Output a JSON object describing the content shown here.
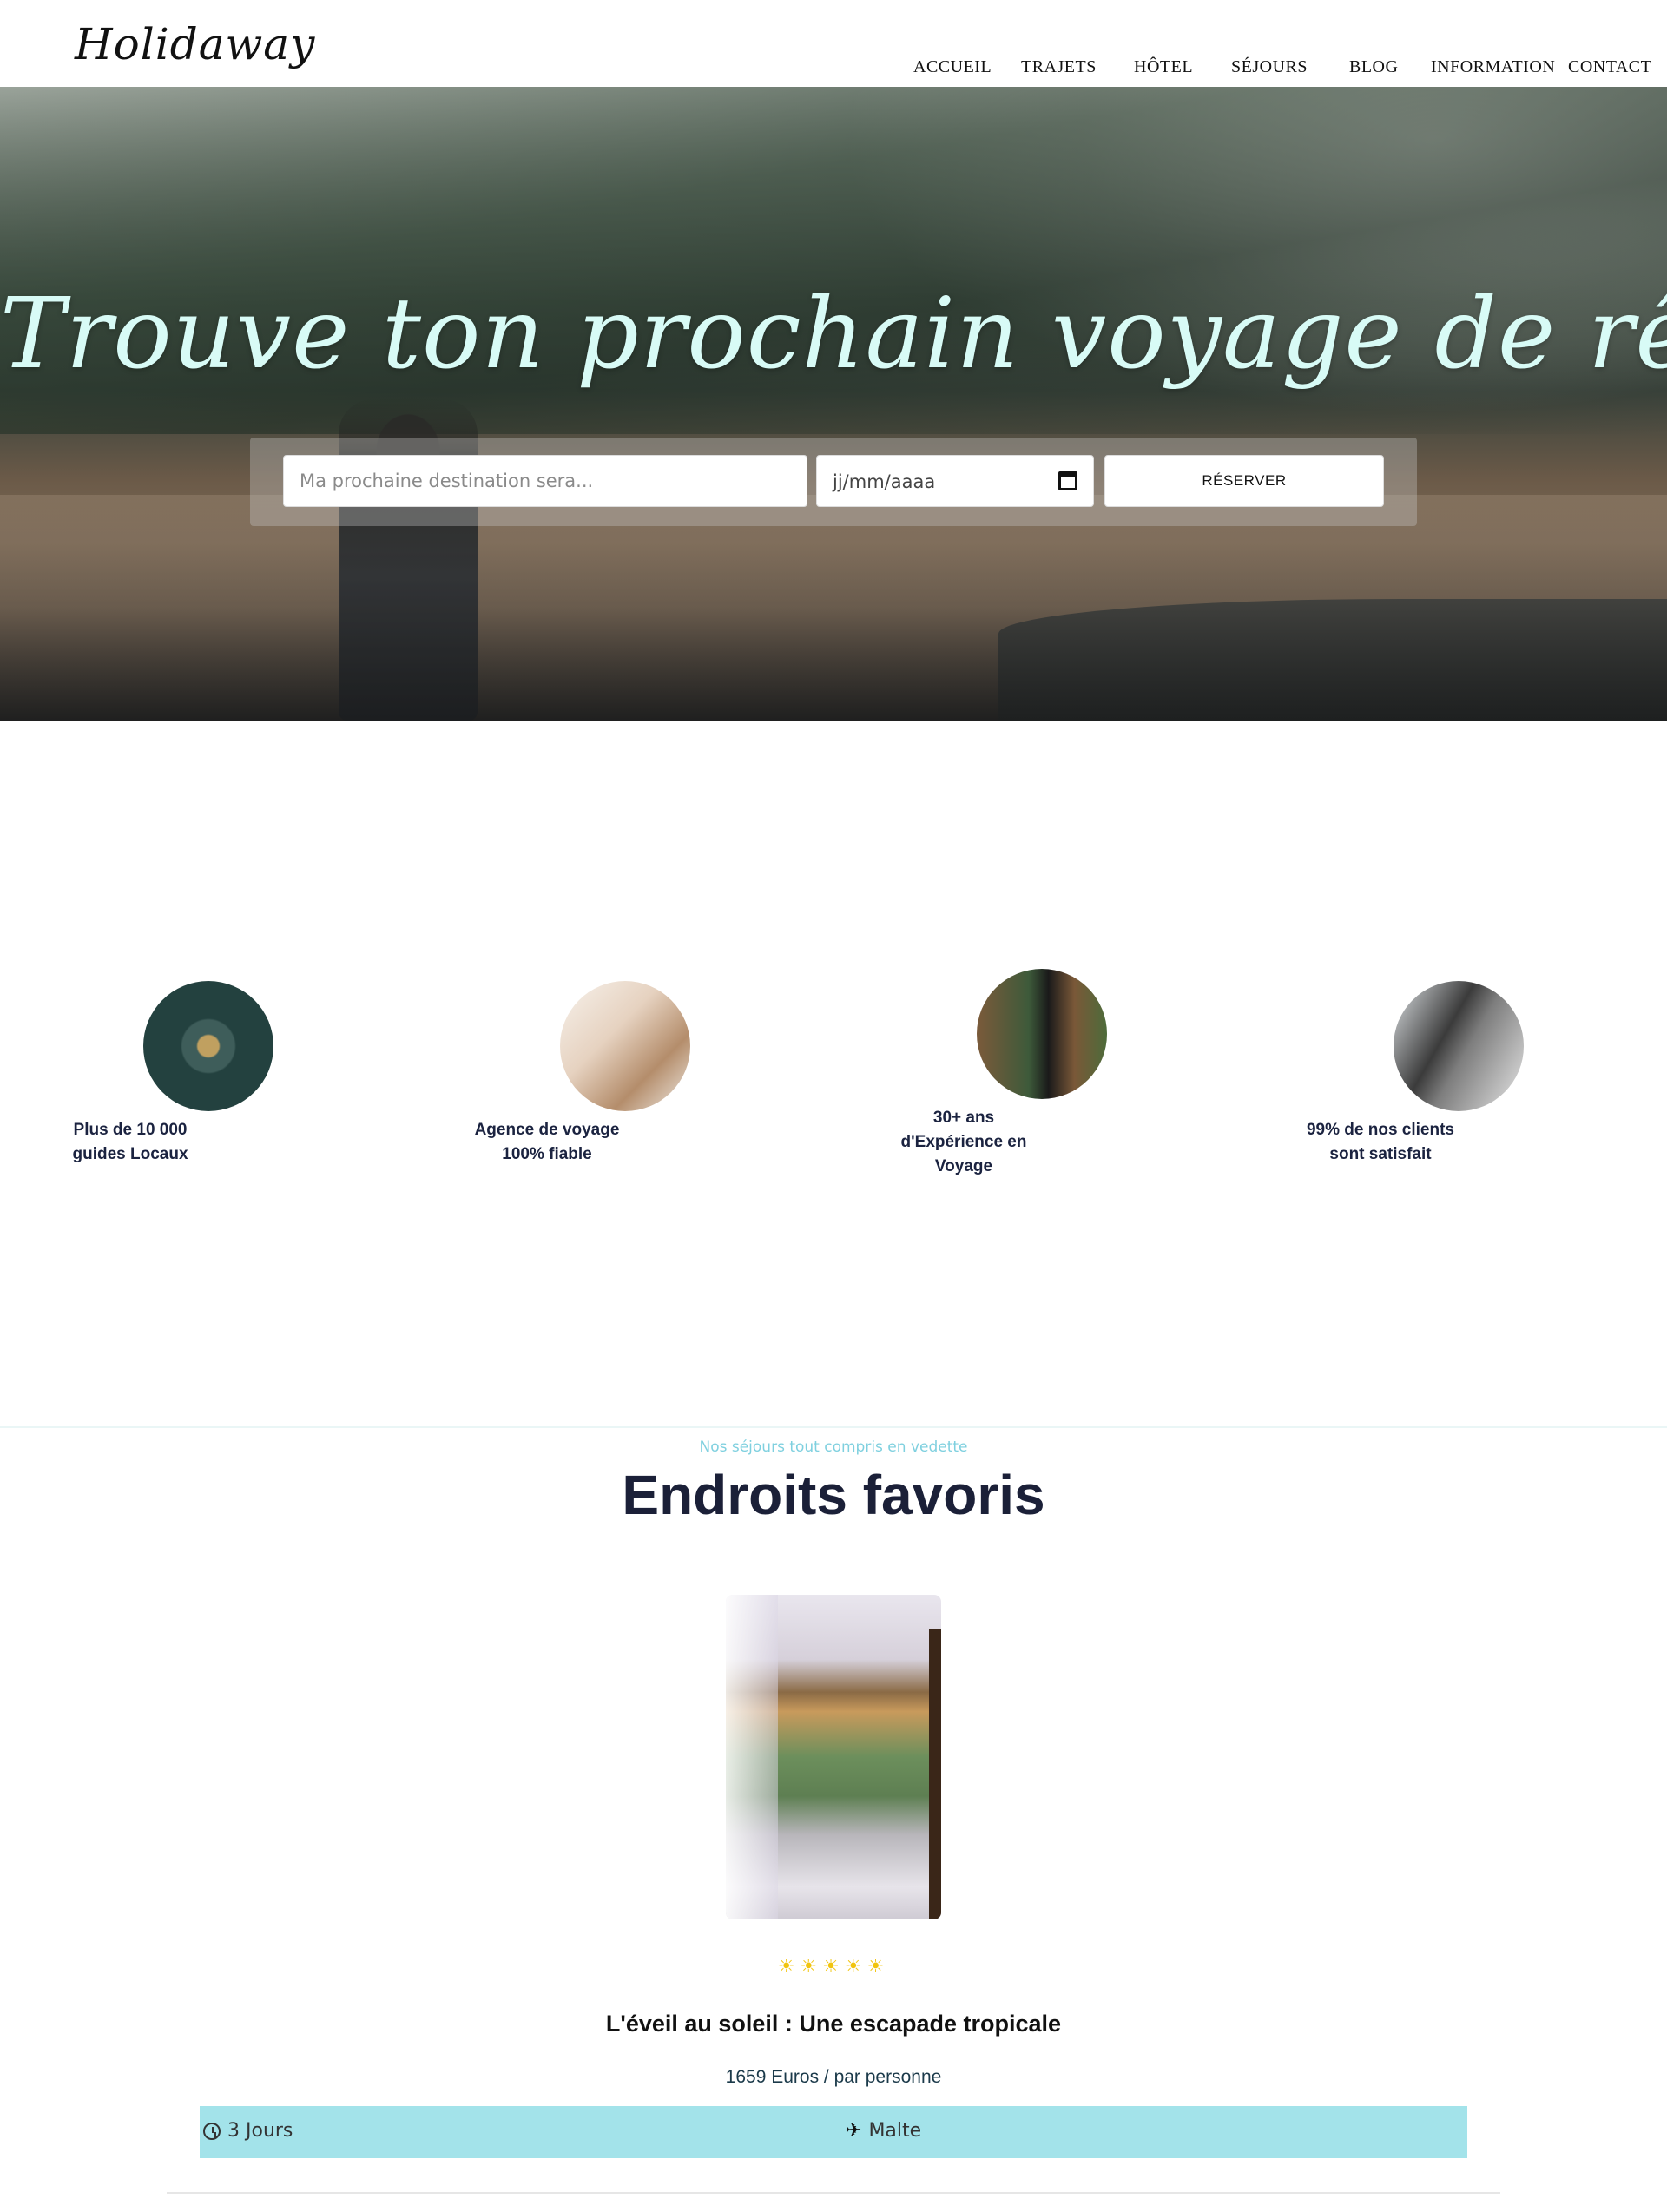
{
  "header": {
    "logo": "Holidaway",
    "nav": [
      {
        "label": "ACCUEIL"
      },
      {
        "label": "TRAJETS"
      },
      {
        "label": "HÔTEL"
      },
      {
        "label": "SÉJOURS"
      },
      {
        "label": "BLOG"
      },
      {
        "label": "INFORMATION"
      },
      {
        "label": "CONTACT"
      }
    ]
  },
  "hero": {
    "title": "Trouve ton prochain voyage de rêve !",
    "destination_placeholder": "Ma prochaine destination sera...",
    "date_placeholder": "jj/mm/aaaa",
    "reserve_label": "RÉSERVER"
  },
  "features": [
    {
      "line1": "Plus de 10 000",
      "line2": "guides Locaux",
      "line3": ""
    },
    {
      "line1": "Agence de voyage",
      "line2": "100% fiable",
      "line3": ""
    },
    {
      "line1": "30+ ans",
      "line2": "d'Expérience en",
      "line3": "Voyage"
    },
    {
      "line1": "99% de nos clients",
      "line2": "sont satisfait",
      "line3": ""
    }
  ],
  "favorites": {
    "subtitle": "Nos séjours tout compris en vedette",
    "title": "Endroits favoris",
    "card": {
      "stars": "☀☀☀☀☀",
      "rating": 5,
      "title": "L'éveil au soleil : Une escapade tropicale",
      "price": "1659 Euros / par personne",
      "duration": "3 Jours",
      "destination": "Malte"
    }
  },
  "colors": {
    "hero_title": "#d8fbf6",
    "accent_teal": "#a3e3ea",
    "subtitle_teal": "#7fd0df",
    "heading_navy": "#1b2038",
    "star_yellow": "#f1c40f"
  }
}
